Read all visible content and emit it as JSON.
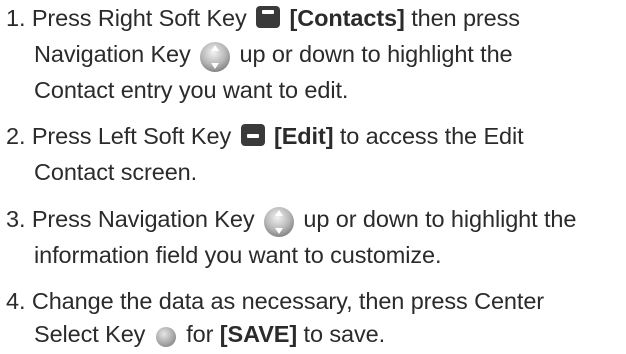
{
  "steps": [
    {
      "number": "1.",
      "line1": {
        "text_a": "Press Right Soft Key",
        "bold": "[Contacts]",
        "text_b": "then press"
      },
      "line2": {
        "text_a": "Navigation Key",
        "text_b": "up or down to highlight the"
      },
      "line3": "Contact entry you want to edit."
    },
    {
      "number": "2.",
      "line1": {
        "text_a": "Press Left Soft Key",
        "bold": "[Edit]",
        "text_b": "to access the Edit"
      },
      "line2": "Contact screen."
    },
    {
      "number": "3.",
      "line1": {
        "text_a": "Press Navigation Key",
        "text_b": "up or down to highlight the"
      },
      "line2": "information field you want to customize."
    },
    {
      "number": "4.",
      "line1": "Change the data as necessary, then press Center",
      "line2": {
        "text_a": "Select Key",
        "text_b": "for",
        "bold": "[SAVE]",
        "text_c": "to save."
      }
    }
  ],
  "icons": {
    "right_soft_key": "right-soft-key-icon",
    "left_soft_key": "left-soft-key-icon",
    "navigation_key": "navigation-key-icon",
    "center_select_key": "center-select-key-icon"
  },
  "colors": {
    "text": "#2b2b2b",
    "key_dark": "#3a3a3a",
    "key_light": "#bcbcbc"
  }
}
